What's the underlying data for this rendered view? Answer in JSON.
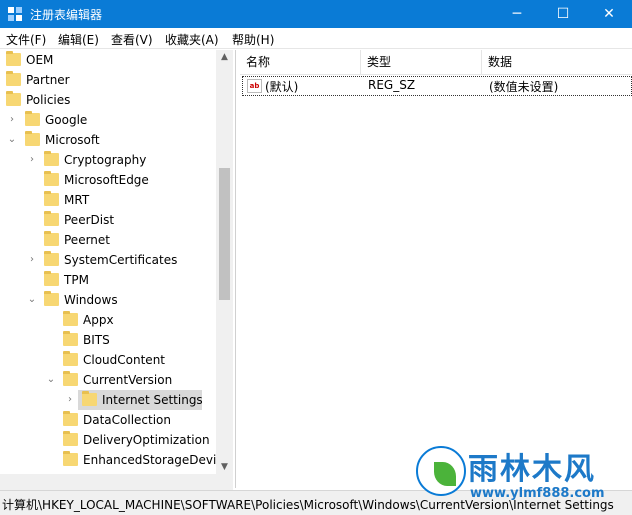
{
  "window": {
    "title": "注册表编辑器",
    "minimize": "─",
    "maximize": "☐",
    "close": "✕"
  },
  "menu": [
    "文件(F)",
    "编辑(E)",
    "查看(V)",
    "收藏夹(A)",
    "帮助(H)"
  ],
  "tree": [
    {
      "label": "OEM",
      "arrow": ""
    },
    {
      "label": "Partner",
      "arrow": ""
    },
    {
      "label": "Policies",
      "arrow": ""
    },
    {
      "label": "Google",
      "arrow": "›"
    },
    {
      "label": "Microsoft",
      "arrow": "⌄"
    },
    {
      "label": "Cryptography",
      "arrow": "›"
    },
    {
      "label": "MicrosoftEdge",
      "arrow": ""
    },
    {
      "label": "MRT",
      "arrow": ""
    },
    {
      "label": "PeerDist",
      "arrow": ""
    },
    {
      "label": "Peernet",
      "arrow": ""
    },
    {
      "label": "SystemCertificates",
      "arrow": "›"
    },
    {
      "label": "TPM",
      "arrow": ""
    },
    {
      "label": "Windows",
      "arrow": "⌄"
    },
    {
      "label": "Appx",
      "arrow": ""
    },
    {
      "label": "BITS",
      "arrow": ""
    },
    {
      "label": "CloudContent",
      "arrow": ""
    },
    {
      "label": "CurrentVersion",
      "arrow": "⌄"
    },
    {
      "label": "Internet Settings",
      "arrow": "›"
    },
    {
      "label": "DataCollection",
      "arrow": ""
    },
    {
      "label": "DeliveryOptimization",
      "arrow": ""
    },
    {
      "label": "EnhancedStorageDevic",
      "arrow": ""
    }
  ],
  "list": {
    "columns": [
      "名称",
      "类型",
      "数据"
    ],
    "rows": [
      {
        "icon": "ab",
        "name": "(默认)",
        "type": "REG_SZ",
        "data": "(数值未设置)"
      }
    ]
  },
  "status": {
    "path": "计算机\\HKEY_LOCAL_MACHINE\\SOFTWARE\\Policies\\Microsoft\\Windows\\CurrentVersion\\Internet Settings"
  },
  "scroll": {
    "up": "▲",
    "down": "▼"
  },
  "watermark": {
    "title": "雨林木风",
    "url": "www.ylmf888.com"
  }
}
